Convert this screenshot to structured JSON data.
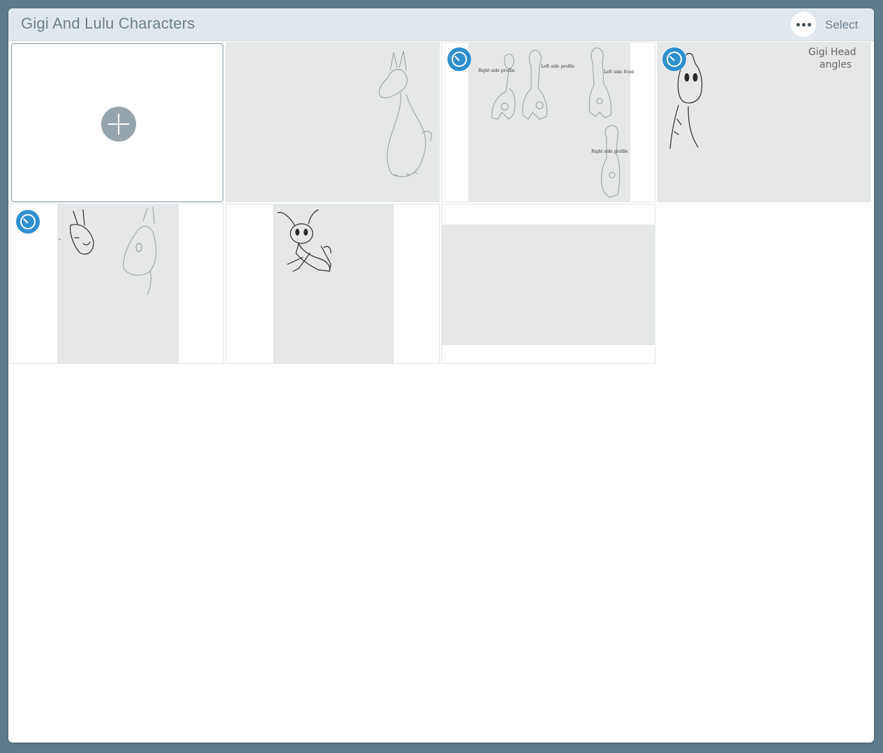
{
  "header": {
    "title": "Gigi And Lulu Characters",
    "select_label": "Select"
  },
  "tiles": [
    {
      "type": "add"
    },
    {
      "type": "sketch",
      "subject": "llama-sketch"
    },
    {
      "type": "sketch",
      "subject": "giraffe-turnaround-sketch",
      "timelapse": true,
      "labels": [
        "Right side profile",
        "Left side profile",
        "Left side front",
        "Right side profile"
      ]
    },
    {
      "type": "sketch",
      "subject": "giraffe-head-angles-sketch",
      "timelapse": true,
      "labels": [
        "Gigi Head",
        "angles"
      ]
    },
    {
      "type": "sketch",
      "subject": "llama-heads-sketch",
      "timelapse": true
    },
    {
      "type": "sketch",
      "subject": "grasshopper-sketch"
    },
    {
      "type": "sketch",
      "subject": "blank-paper"
    }
  ],
  "icons": {
    "add": "plus-icon",
    "more": "more-horizontal-icon",
    "timelapse": "timelapse-icon"
  },
  "colors": {
    "background": "#5f7a88",
    "header": "#e1e8ed",
    "accent": "#2f8fce",
    "paper": "#e6e8e8"
  }
}
